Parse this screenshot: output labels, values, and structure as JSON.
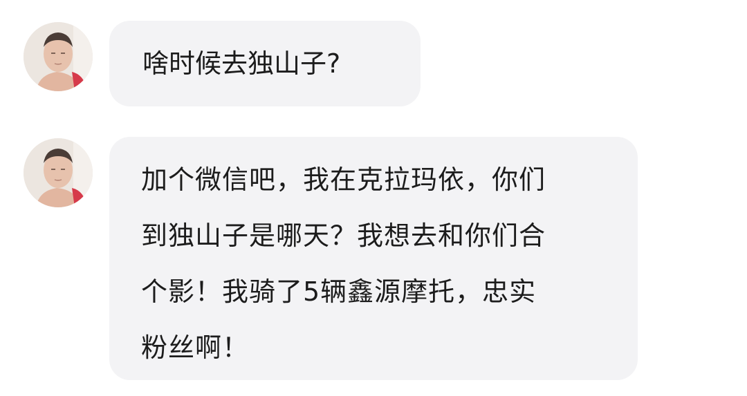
{
  "messages": [
    {
      "avatar_icon": "user-avatar-icon",
      "text": "啥时候去独山子?"
    },
    {
      "avatar_icon": "user-avatar-icon",
      "lines": [
        "加个微信吧，我在克拉玛依，你们",
        "到独山子是哪天？我想去和你们合",
        "个影！我骑了5辆鑫源摩托，忠实",
        "粉丝啊！"
      ]
    }
  ],
  "colors": {
    "background": "#ffffff",
    "bubble": "#f3f3f5",
    "text": "#1c1c1c"
  }
}
